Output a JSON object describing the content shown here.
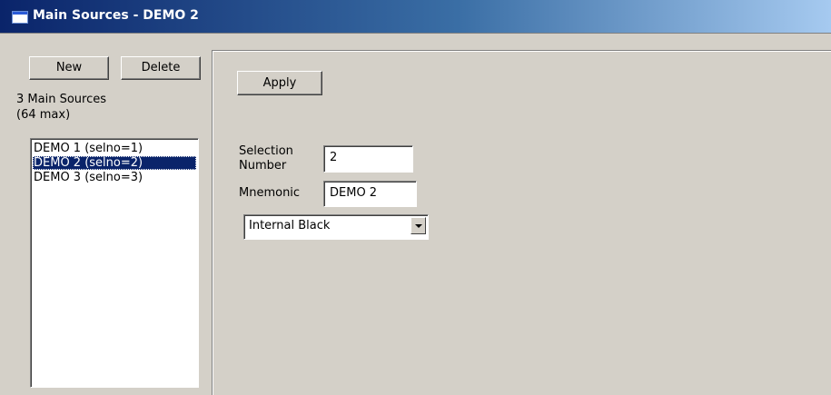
{
  "window": {
    "title": "Main Sources - DEMO 2"
  },
  "left": {
    "new_label": "New",
    "delete_label": "Delete",
    "count_text": "3 Main Sources",
    "max_text": "(64 max)",
    "sources": [
      "DEMO 1 (selno=1)",
      "DEMO 2 (selno=2)",
      "DEMO 3 (selno=3)"
    ],
    "selected_index": 1
  },
  "right": {
    "apply_label": "Apply",
    "selection_label_line1": "Selection",
    "selection_label_line2": "Number",
    "selection_value": "2",
    "mnemonic_label": "Mnemonic",
    "mnemonic_value": "DEMO 2",
    "source_type_value": "Internal Black"
  },
  "colors": {
    "selection_highlight": "#0a246a",
    "window_face": "#d4d0c8"
  }
}
